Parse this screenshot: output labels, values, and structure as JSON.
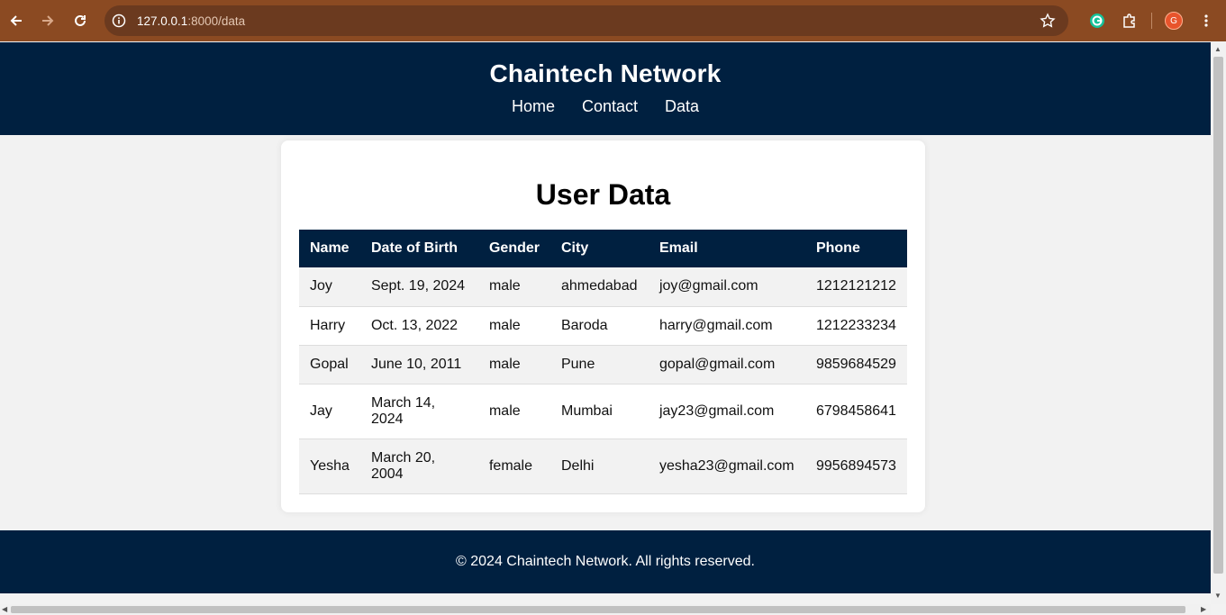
{
  "browser": {
    "url_host": "127.0.0.1",
    "url_path": ":8000/data",
    "profile_initial": "G"
  },
  "site": {
    "title": "Chaintech Network",
    "nav": [
      "Home",
      "Contact",
      "Data"
    ]
  },
  "page": {
    "heading": "User Data",
    "table": {
      "columns": [
        "Name",
        "Date of Birth",
        "Gender",
        "City",
        "Email",
        "Phone"
      ],
      "rows": [
        [
          "Joy",
          "Sept. 19, 2024",
          "male",
          "ahmedabad",
          "joy@gmail.com",
          "1212121212"
        ],
        [
          "Harry",
          "Oct. 13, 2022",
          "male",
          "Baroda",
          "harry@gmail.com",
          "1212233234"
        ],
        [
          "Gopal",
          "June 10, 2011",
          "male",
          "Pune",
          "gopal@gmail.com",
          "9859684529"
        ],
        [
          "Jay",
          "March 14, 2024",
          "male",
          "Mumbai",
          "jay23@gmail.com",
          "6798458641"
        ],
        [
          "Yesha",
          "March 20, 2004",
          "female",
          "Delhi",
          "yesha23@gmail.com",
          "9956894573"
        ]
      ]
    }
  },
  "footer": {
    "text": "© 2024 Chaintech Network. All rights reserved."
  },
  "icons": {
    "back": "arrow-left-icon",
    "forward": "arrow-right-icon",
    "reload": "reload-icon",
    "info": "info-icon",
    "bookmark": "star-icon",
    "grammarly": "grammarly-icon",
    "extensions": "puzzle-icon",
    "menu": "kebab-menu-icon"
  },
  "colors": {
    "chrome": "#8b4a22",
    "omnibox": "#6b3a1f",
    "brand_navy": "#002040",
    "page_bg": "#f2f2f2"
  }
}
